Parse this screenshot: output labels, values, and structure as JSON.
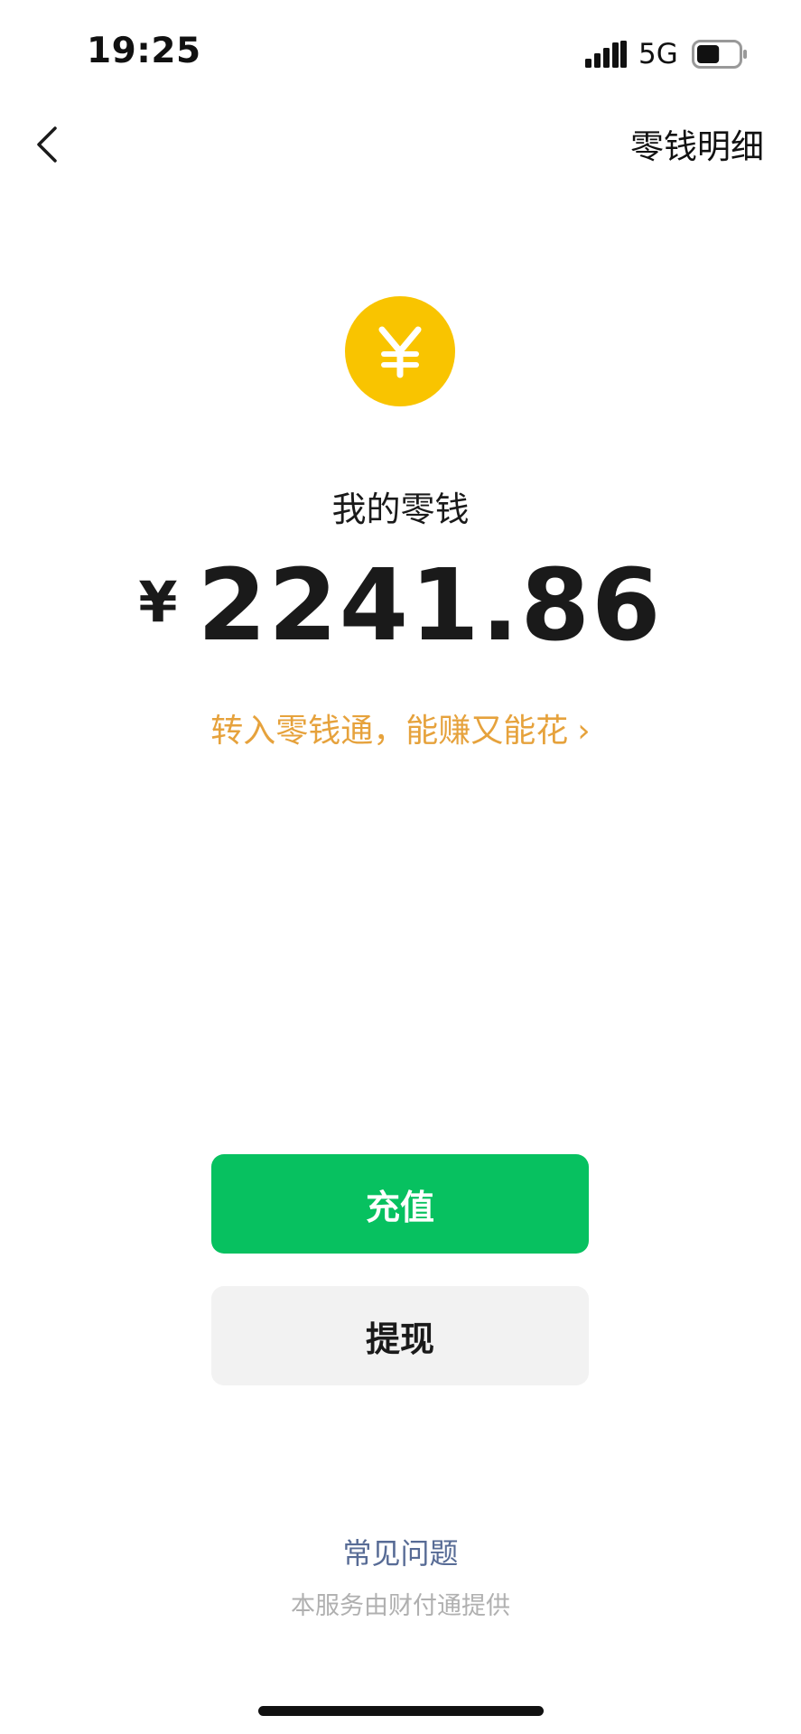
{
  "status_bar": {
    "time": "19:25",
    "network": "5G",
    "battery_level": 0.55
  },
  "nav": {
    "back_icon": "chevron-left-icon",
    "details_label": "零钱明细"
  },
  "wallet": {
    "icon": "yen-coin-icon",
    "icon_color": "#f9c400",
    "icon_glyph": "¥",
    "label": "我的零钱",
    "currency_symbol": "¥",
    "balance": "2241.86",
    "promo_text": "转入零钱通，能赚又能花",
    "promo_chevron": "›",
    "promo_color": "#e6a23c"
  },
  "actions": {
    "topup_label": "充值",
    "topup_color": "#07c160",
    "withdraw_label": "提现"
  },
  "footer": {
    "faq_label": "常见问题",
    "provider_note": "本服务由财付通提供"
  }
}
